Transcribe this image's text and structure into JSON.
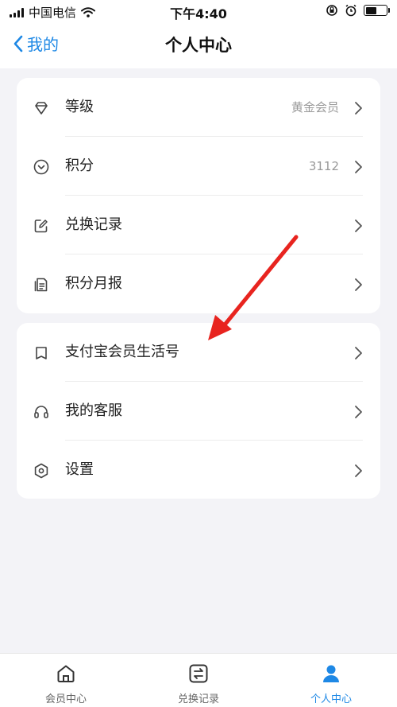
{
  "status": {
    "carrier": "中国电信",
    "time": "下午4:40"
  },
  "nav": {
    "back_label": "我的",
    "title": "个人中心"
  },
  "card1": [
    {
      "label": "等级",
      "value": "黄金会员",
      "icon": "diamond-icon"
    },
    {
      "label": "积分",
      "value": "3112",
      "icon": "circle-chevron-icon"
    },
    {
      "label": "兑换记录",
      "value": "",
      "icon": "edit-icon"
    },
    {
      "label": "积分月报",
      "value": "",
      "icon": "report-icon"
    }
  ],
  "card2": [
    {
      "label": "支付宝会员生活号",
      "value": "",
      "icon": "book-icon"
    },
    {
      "label": "我的客服",
      "value": "",
      "icon": "headset-icon"
    },
    {
      "label": "设置",
      "value": "",
      "icon": "hexagon-gear-icon"
    }
  ],
  "tabbar": [
    {
      "label": "会员中心",
      "icon": "home-icon"
    },
    {
      "label": "兑换记录",
      "icon": "exchange-icon"
    },
    {
      "label": "个人中心",
      "icon": "user-icon"
    }
  ],
  "colors": {
    "accent": "#1e88e5",
    "arrow": "#e8241f",
    "background": "#f3f3f7"
  }
}
